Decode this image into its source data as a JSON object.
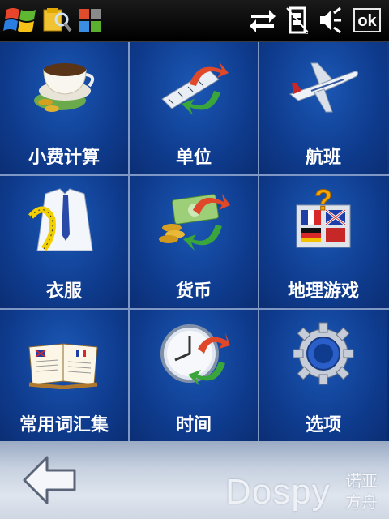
{
  "status_bar": {
    "start_icon": "windows-flag-icon",
    "explorer_icon": "explorer-search-icon",
    "tiles_icon": "multicolor-tiles-icon",
    "sync_icon": "sync-arrows-icon",
    "battery_icon": "sim-battery-icon",
    "speaker_icon": "speaker-icon",
    "ok_label": "ok"
  },
  "tiles": [
    {
      "label": "小费计算",
      "icon": "coffee-cup-coins-icon"
    },
    {
      "label": "单位",
      "icon": "ruler-convert-icon"
    },
    {
      "label": "航班",
      "icon": "airplane-icon"
    },
    {
      "label": "衣服",
      "icon": "shirt-measure-icon"
    },
    {
      "label": "货币",
      "icon": "money-convert-icon"
    },
    {
      "label": "地理游戏",
      "icon": "flags-quiz-icon"
    },
    {
      "label": "常用词汇集",
      "icon": "phrasebook-icon"
    },
    {
      "label": "时间",
      "icon": "clock-convert-icon"
    },
    {
      "label": "选项",
      "icon": "gear-icon"
    }
  ],
  "bottom_bar": {
    "back_icon": "back-arrow-icon",
    "brand": "Dospy",
    "brand_cn": "诺亚方舟"
  },
  "colors": {
    "tile_blue": "#1b58b5",
    "grid_line": "#7f97c4",
    "status_bg": "#000000"
  }
}
